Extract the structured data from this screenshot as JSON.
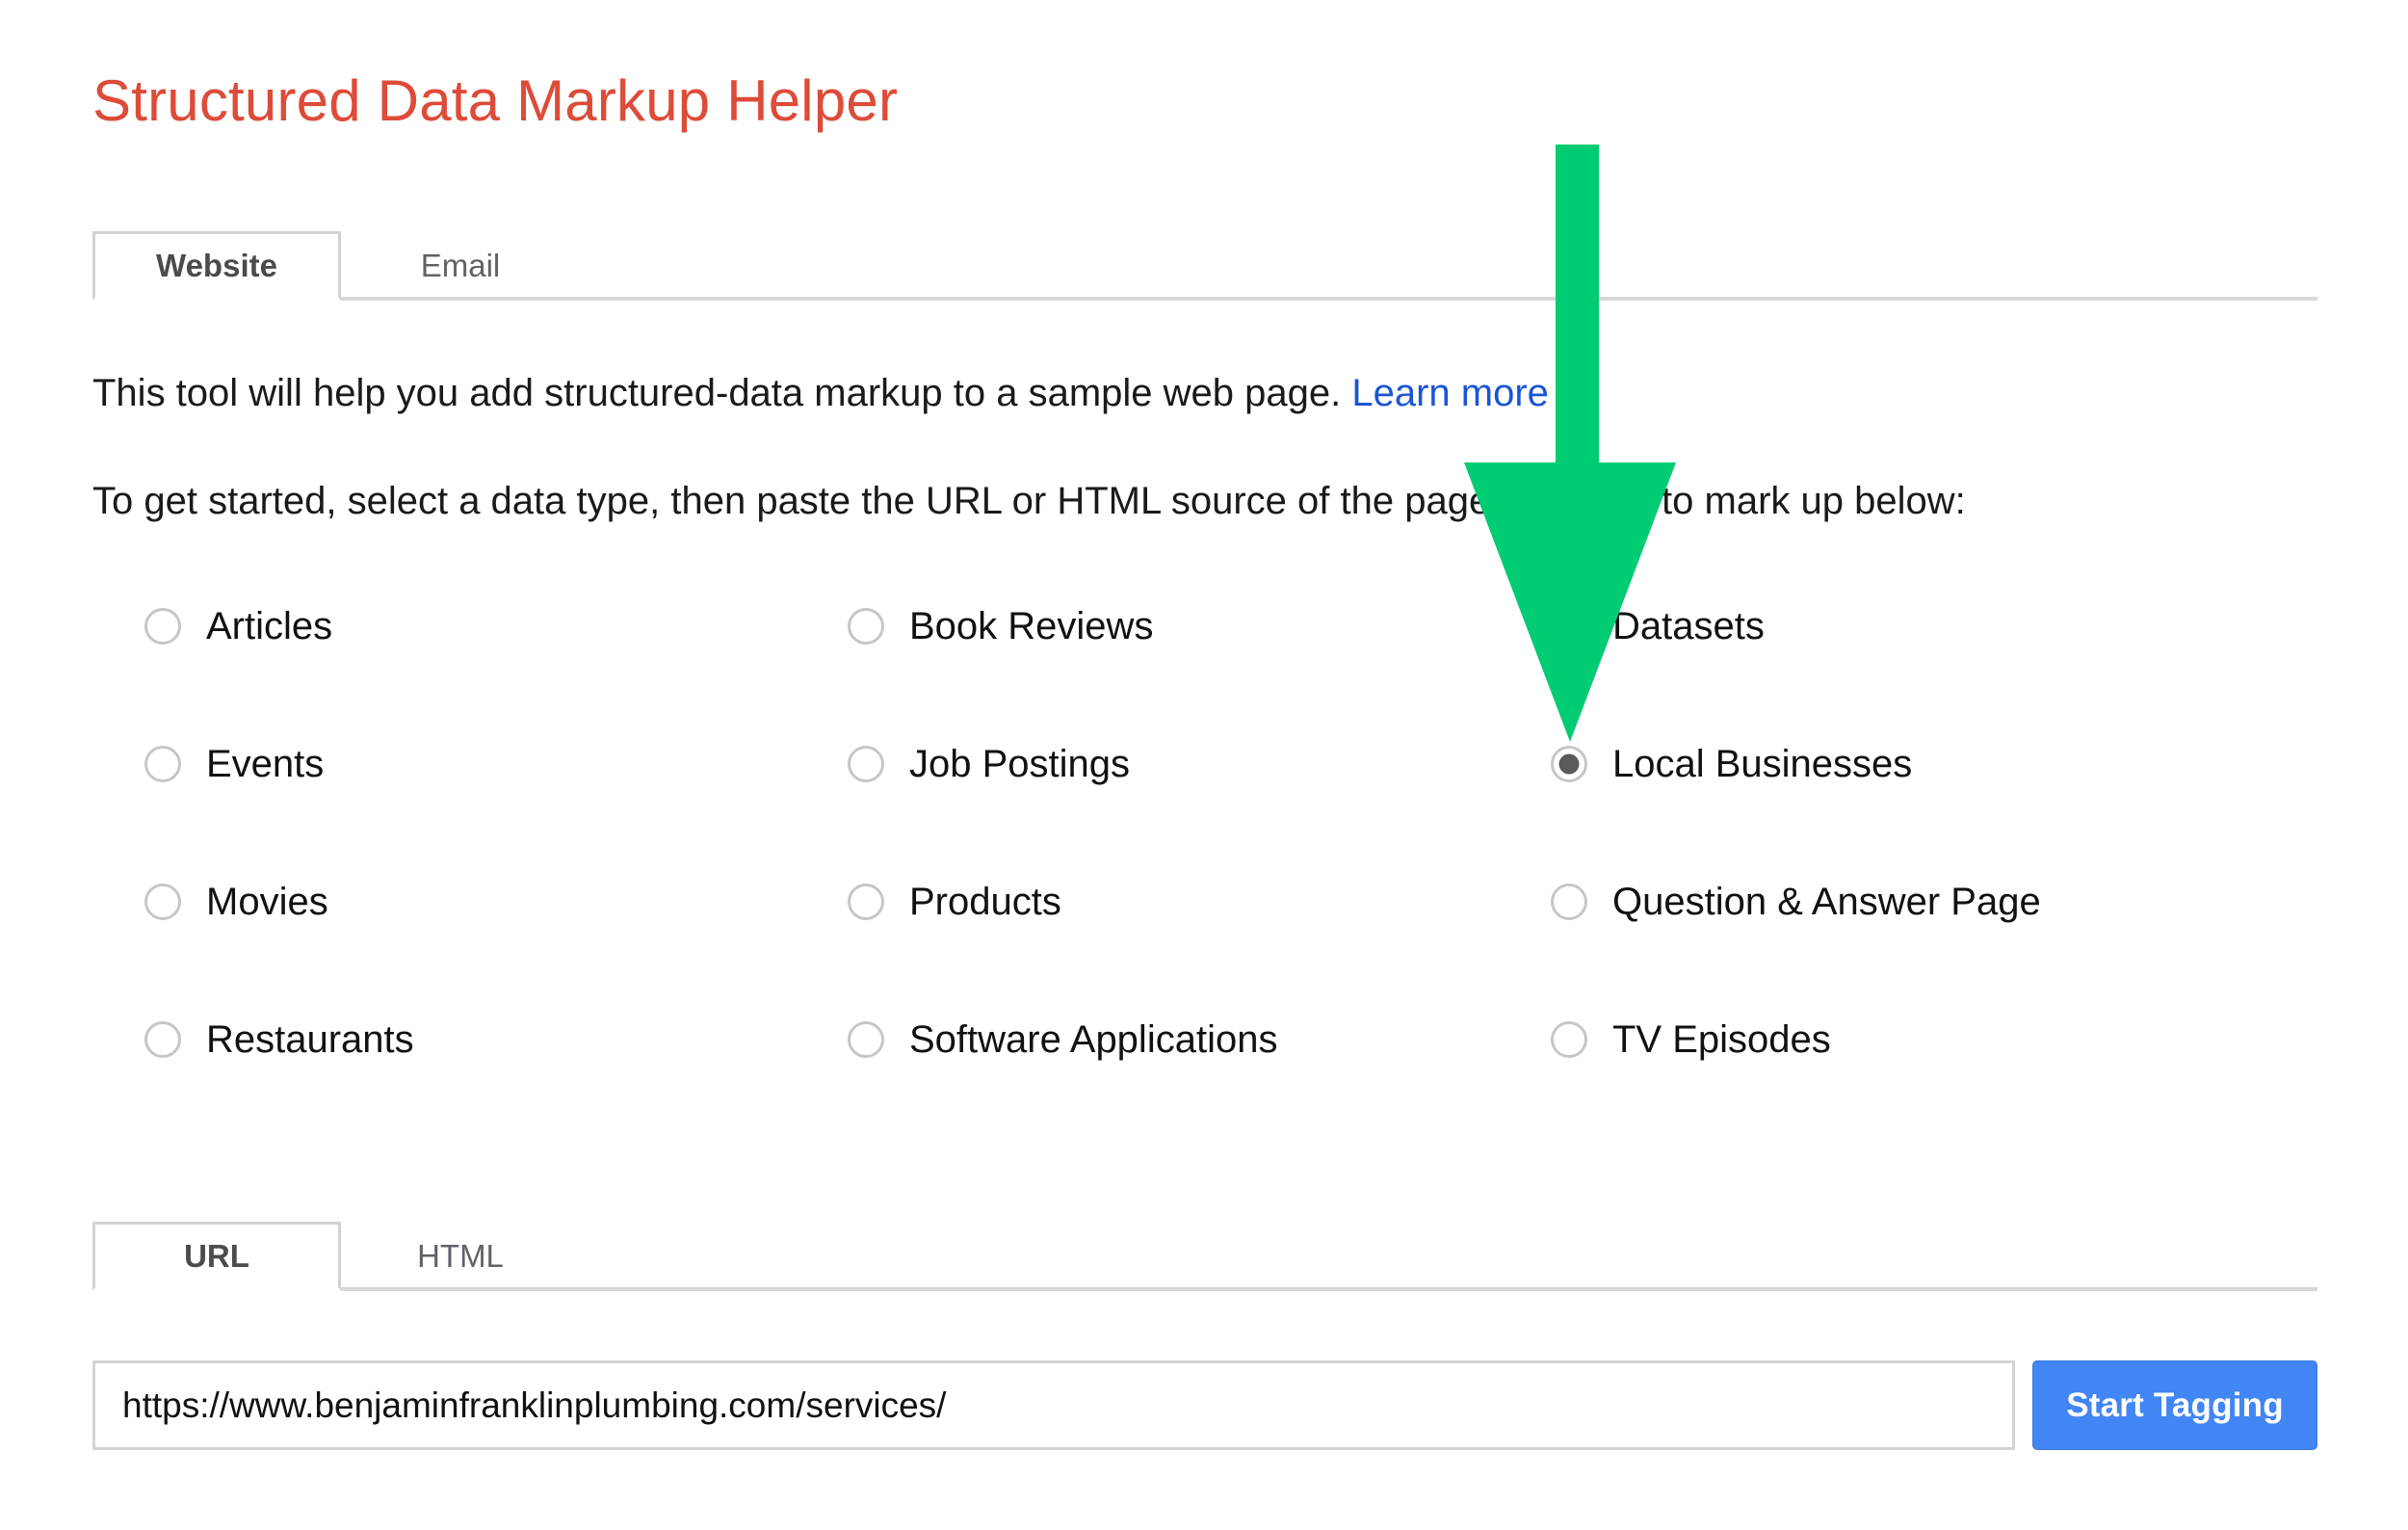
{
  "app": {
    "title": "Structured Data Markup Helper"
  },
  "main_tabs": {
    "items": [
      {
        "label": "Website",
        "active": true
      },
      {
        "label": "Email",
        "active": false
      }
    ]
  },
  "intro": {
    "line1_text": "This tool will help you add structured-data markup to a sample web page. ",
    "line1_link": "Learn more",
    "line2": "To get started, select a data type, then paste the URL or HTML source of the page you wish to mark up below:"
  },
  "data_types": {
    "selected": "Local Businesses",
    "rows": [
      [
        {
          "label": "Articles",
          "checked": false
        },
        {
          "label": "Book Reviews",
          "checked": false
        },
        {
          "label": "Datasets",
          "checked": false
        }
      ],
      [
        {
          "label": "Events",
          "checked": false
        },
        {
          "label": "Job Postings",
          "checked": false
        },
        {
          "label": "Local Businesses",
          "checked": true
        }
      ],
      [
        {
          "label": "Movies",
          "checked": false
        },
        {
          "label": "Products",
          "checked": false
        },
        {
          "label": "Question & Answer Page",
          "checked": false
        }
      ],
      [
        {
          "label": "Restaurants",
          "checked": false
        },
        {
          "label": "Software Applications",
          "checked": false
        },
        {
          "label": "TV Episodes",
          "checked": false
        }
      ]
    ]
  },
  "source_tabs": {
    "items": [
      {
        "label": "URL",
        "active": true
      },
      {
        "label": "HTML",
        "active": false
      }
    ]
  },
  "entry": {
    "url_value": "https://www.benjaminfranklinplumbing.com/services/",
    "url_placeholder": "",
    "start_button": "Start Tagging"
  },
  "annotation": {
    "arrow": "down-arrow-annotation",
    "color": "#00cc73"
  },
  "colors": {
    "title": "#dd4b39",
    "link": "#1a55d6",
    "button": "#4285f4",
    "arrow_green": "#00cc73",
    "radio_border": "#c6c6c6",
    "radio_dot": "#5a5a5a"
  }
}
